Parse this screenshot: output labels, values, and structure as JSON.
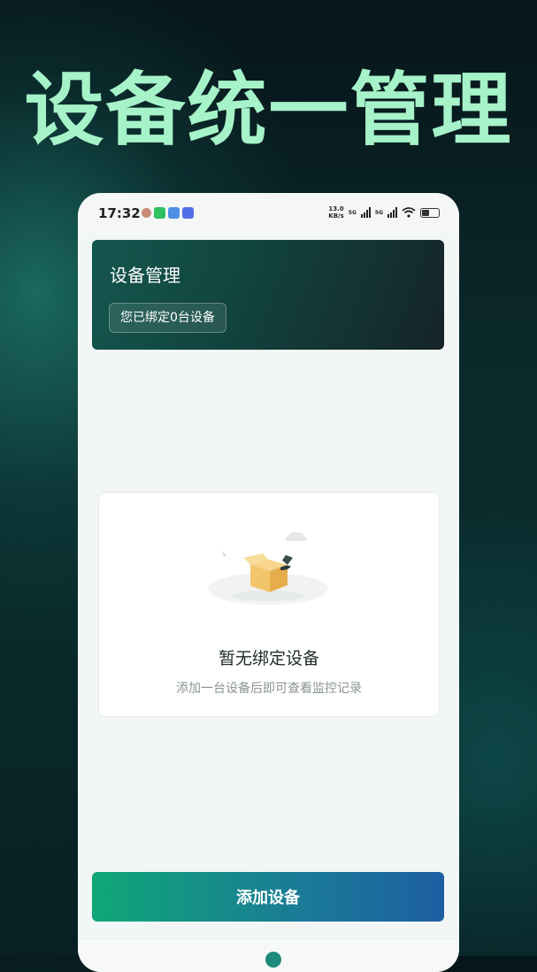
{
  "hero": {
    "title": "设备统一管理"
  },
  "status_bar": {
    "time": "17:32",
    "net_speed_value": "13.0",
    "net_speed_unit": "KB/s",
    "sim1_label": "5G",
    "sim2_label": "5G",
    "icons": [
      "avatar-icon",
      "wechat-icon",
      "app-icon",
      "app-icon-2",
      "wifi-icon",
      "battery-icon"
    ]
  },
  "header": {
    "title": "设备管理",
    "badge": "您已绑定0台设备"
  },
  "empty_state": {
    "title": "暂无绑定设备",
    "subtitle": "添加一台设备后即可查看监控记录"
  },
  "actions": {
    "add_device_label": "添加设备"
  },
  "colors": {
    "hero_text": "#a6f3c9",
    "header_gradient_start": "#14574f",
    "header_gradient_end": "#152428",
    "button_gradient_start": "#10a777",
    "button_gradient_end": "#1e5fa3"
  }
}
